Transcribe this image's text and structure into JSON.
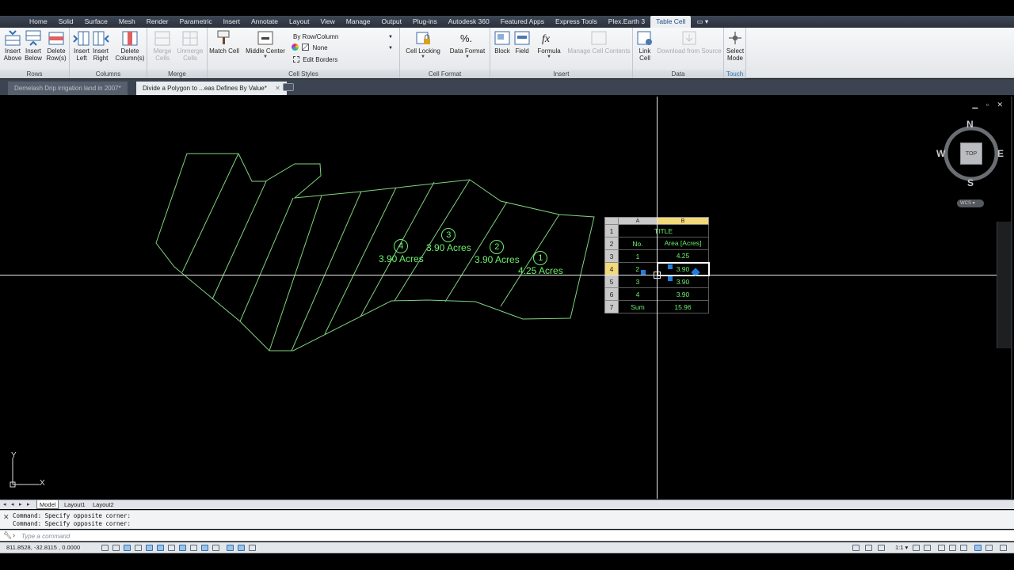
{
  "menu_tabs": [
    "Home",
    "Solid",
    "Surface",
    "Mesh",
    "Render",
    "Parametric",
    "Insert",
    "Annotate",
    "Layout",
    "View",
    "Manage",
    "Output",
    "Plug-ins",
    "Autodesk 360",
    "Featured Apps",
    "Express Tools",
    "Plex.Earth 3",
    "Table Cell"
  ],
  "menu_extra": "▭ ▾",
  "ribbon": {
    "rows": {
      "insert_above": "Insert Above",
      "insert_below": "Insert Below",
      "delete_rows": "Delete Row(s)",
      "label": "Rows"
    },
    "columns": {
      "insert_left": "Insert Left",
      "insert_right": "Insert Right",
      "delete_columns": "Delete Column(s)",
      "label": "Columns"
    },
    "merge": {
      "merge_cells": "Merge Cells",
      "unmerge_cells": "Unmerge Cells",
      "label": "Merge"
    },
    "cell_styles": {
      "match_cell": "Match Cell",
      "middle_center": "Middle Center",
      "by_row_column": "By Row/Column",
      "none": "None",
      "edit_borders": "Edit Borders",
      "label": "Cell Styles"
    },
    "cell_format": {
      "cell_locking": "Cell Locking",
      "data_format": "Data Format",
      "label": "Cell Format"
    },
    "insert": {
      "block": "Block",
      "field": "Field",
      "formula": "Formula",
      "manage_cell_contents": "Manage Cell Contents",
      "label": "Insert"
    },
    "data": {
      "link_cell": "Link Cell",
      "download_from_source": "Download from Source",
      "label": "Data"
    },
    "touch": {
      "select_mode": "Select Mode",
      "label": "Touch"
    }
  },
  "doc_tabs": [
    {
      "label": "Demelash Drip irrigation land in 2007*",
      "active": false
    },
    {
      "label": "Divide a Polygon to ...eas Defines By Value*",
      "active": true
    }
  ],
  "drawing": {
    "parcels": [
      {
        "number": "4",
        "area": "3.90 Acres"
      },
      {
        "number": "3",
        "area": "3.90 Acres"
      },
      {
        "number": "2",
        "area": "3.90 Acres"
      },
      {
        "number": "1",
        "area": "4.25 Acres"
      }
    ],
    "table": {
      "col_headers": [
        "A",
        "B"
      ],
      "title": "TITLE",
      "header_a": "No.",
      "header_b": "Area [Acres]",
      "rows": [
        {
          "row": "3",
          "a": "1",
          "b": "4.25"
        },
        {
          "row": "4",
          "a": "2",
          "b": "3.90"
        },
        {
          "row": "5",
          "a": "3",
          "b": "3.90"
        },
        {
          "row": "6",
          "a": "4",
          "b": "3.90"
        },
        {
          "row": "7",
          "a": "Sum",
          "b": "15.96"
        }
      ],
      "row_numbers": [
        "1",
        "2"
      ]
    }
  },
  "viewcube": {
    "n": "N",
    "s": "S",
    "e": "E",
    "w": "W",
    "top": "TOP",
    "wcs": "WCS ▾"
  },
  "ucs": {
    "x": "X",
    "y": "Y"
  },
  "layout_tabs": [
    "Model",
    "Layout1",
    "Layout2"
  ],
  "command_history": [
    "Command: Specify opposite corner:",
    "Command: Specify opposite corner:"
  ],
  "command_placeholder": "Type a command",
  "status": {
    "coords": "811.8528, -32.8115 , 0.0000",
    "scale": "1:1 ▾"
  },
  "colors": {
    "parcel_line": "#7fd37f",
    "label_green": "#6ef06e",
    "accent": "#2f6fb4",
    "selected_header": "#f2d97a"
  }
}
